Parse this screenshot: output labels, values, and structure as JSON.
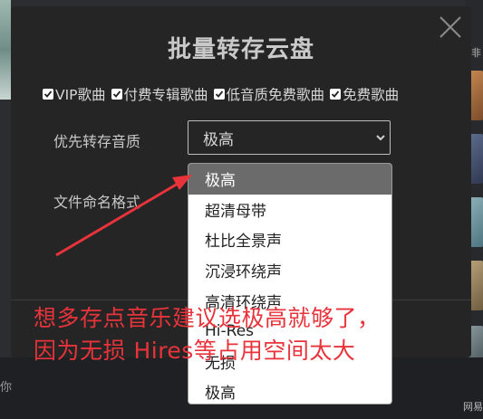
{
  "background": {
    "bottom_left_text": "你",
    "right_text_top": "非",
    "right_text_bottom": "网易"
  },
  "modal": {
    "title": "批量转存云盘",
    "checkboxes": [
      {
        "label": "VIP歌曲",
        "checked": true
      },
      {
        "label": "付费专辑歌曲",
        "checked": true
      },
      {
        "label": "低音质免费歌曲",
        "checked": true
      },
      {
        "label": "免费歌曲",
        "checked": true
      }
    ],
    "quality_label": "优先转存音质",
    "quality_value": "极高",
    "filename_label": "文件命名格式"
  },
  "dropdown": {
    "options": [
      "极高",
      "超清母带",
      "杜比全景声",
      "沉浸环绕声",
      "高清环绕声",
      "Hi-Res",
      "无损",
      "极高"
    ],
    "selected_index": 0
  },
  "annotation": {
    "line1": "想多存点音乐建议选极高就够了，",
    "line2": "因为无损 Hires等占用空间太大"
  },
  "colors": {
    "annotation": "#e8333b",
    "selected_option_bg": "#6b6b6b",
    "modal_bg": "#252525"
  }
}
